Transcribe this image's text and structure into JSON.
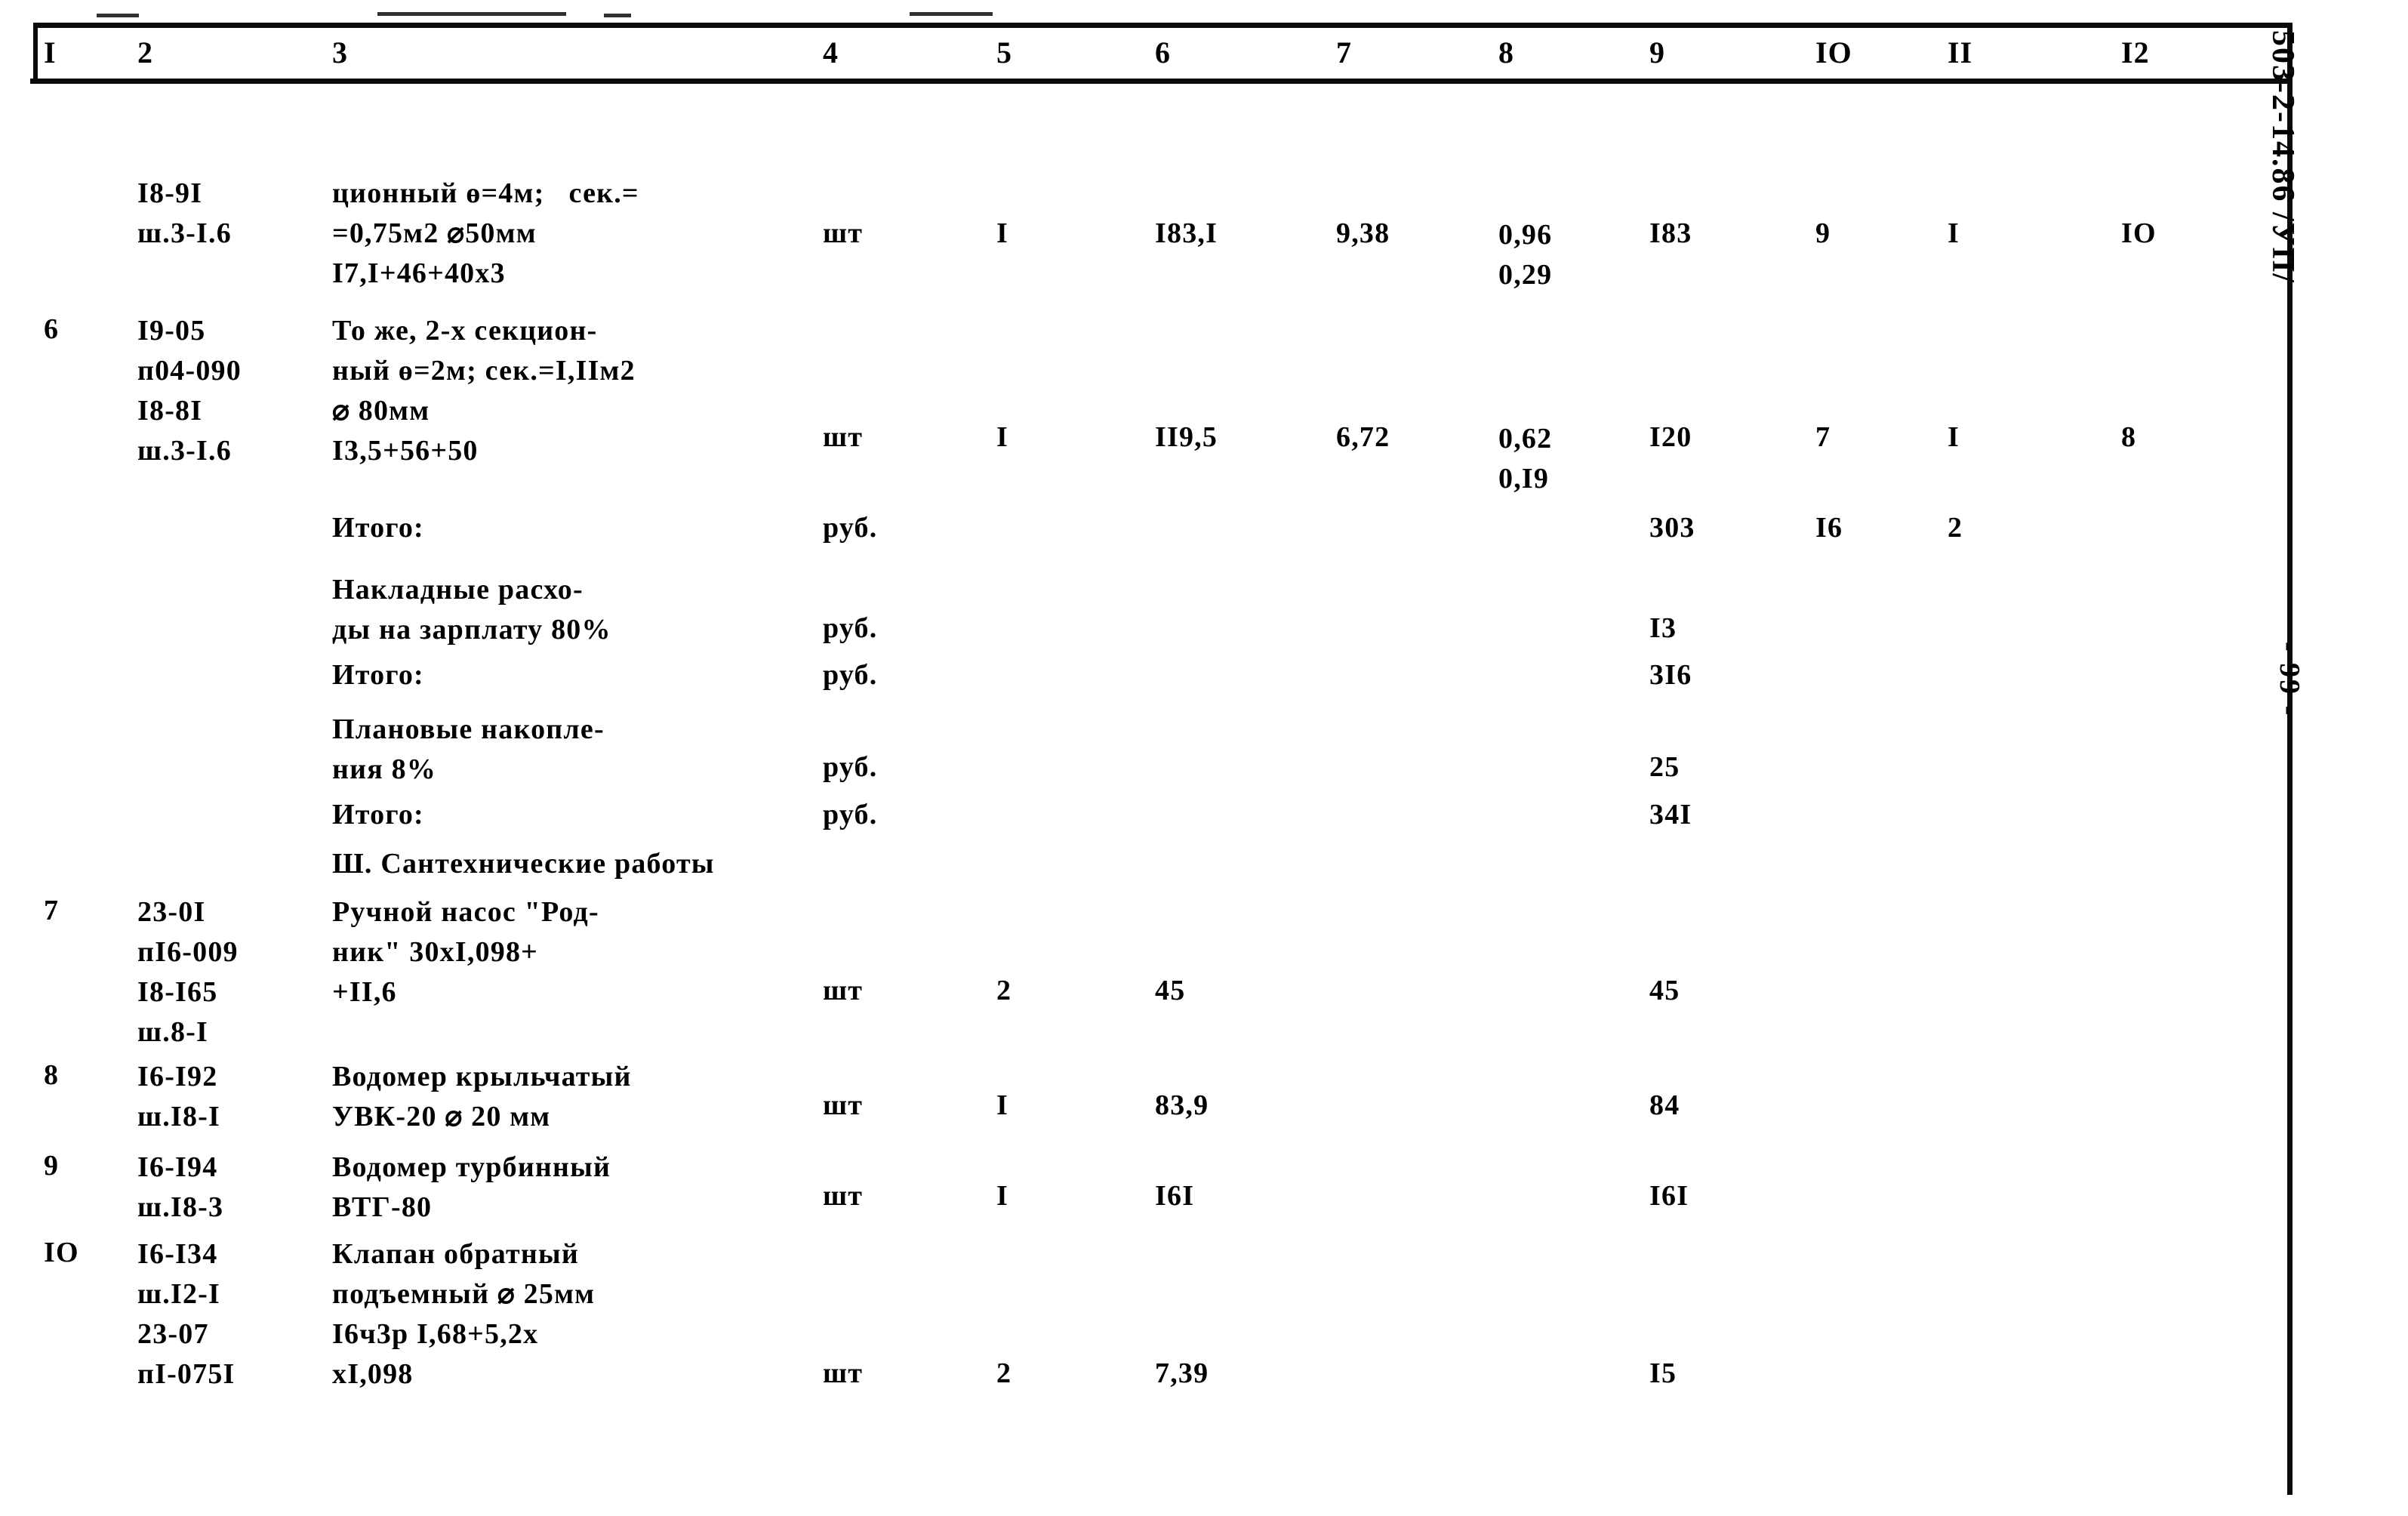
{
  "document": {
    "side_code": "503-2-14.86 /УП/",
    "page_marker": "- 99 -"
  },
  "table": {
    "headers": [
      "I",
      "2",
      "3",
      "4",
      "5",
      "6",
      "7",
      "8",
      "9",
      "IO",
      "II",
      "I2"
    ],
    "rows": [
      {
        "num": "",
        "code": "I8-9I\nш.3-I.6",
        "description": "ционный ө=4м;   сек.=\n=0,75м2 ⌀50мм\nI7,I+46+40х3",
        "unit": "шт",
        "qty": "I",
        "col6": "I83,I",
        "col7": "9,38",
        "col8": "0,96\n0,29",
        "col9": "I83",
        "col10": "9",
        "col11": "I",
        "col12": "IO"
      },
      {
        "num": "6",
        "code": "I9-05\nп04-090\nI8-8I\nш.3-I.6",
        "description": "То же, 2-х секцион-\nный ө=2м; сек.=I,IIм2\n⌀ 80мм\nI3,5+56+50",
        "unit": "шт",
        "qty": "I",
        "col6": "II9,5",
        "col7": "6,72",
        "col8": "0,62\n0,I9",
        "col9": "I20",
        "col10": "7",
        "col11": "I",
        "col12": "8"
      },
      {
        "num": "",
        "code": "",
        "description": "Итого:",
        "unit": "руб.",
        "qty": "",
        "col6": "",
        "col7": "",
        "col8": "",
        "col9": "303",
        "col10": "I6",
        "col11": "2",
        "col12": ""
      },
      {
        "num": "",
        "code": "",
        "description": "Накладные расхо-\nды на зарплату 80%",
        "unit": "руб.",
        "qty": "",
        "col6": "",
        "col7": "",
        "col8": "",
        "col9": "I3",
        "col10": "",
        "col11": "",
        "col12": ""
      },
      {
        "num": "",
        "code": "",
        "description": "Итого:",
        "unit": "руб.",
        "qty": "",
        "col6": "",
        "col7": "",
        "col8": "",
        "col9": "3I6",
        "col10": "",
        "col11": "",
        "col12": ""
      },
      {
        "num": "",
        "code": "",
        "description": "Плановые накопле-\nния 8%",
        "unit": "руб.",
        "qty": "",
        "col6": "",
        "col7": "",
        "col8": "",
        "col9": "25",
        "col10": "",
        "col11": "",
        "col12": ""
      },
      {
        "num": "",
        "code": "",
        "description": "Итого:",
        "unit": "руб.",
        "qty": "",
        "col6": "",
        "col7": "",
        "col8": "",
        "col9": "34I",
        "col10": "",
        "col11": "",
        "col12": ""
      },
      {
        "num": "",
        "code": "",
        "description": "Ш. Сантехнические работы",
        "unit": "",
        "qty": "",
        "col6": "",
        "col7": "",
        "col8": "",
        "col9": "",
        "col10": "",
        "col11": "",
        "col12": ""
      },
      {
        "num": "7",
        "code": "23-0I\nпI6-009\nI8-I65\nш.8-I",
        "description": "Ручной насос \"Род-\nник\" 30хI,098+\n+II,6",
        "unit": "шт",
        "qty": "2",
        "col6": "45",
        "col7": "",
        "col8": "",
        "col9": "45",
        "col10": "",
        "col11": "",
        "col12": ""
      },
      {
        "num": "8",
        "code": "I6-I92\nш.I8-I",
        "description": "Водомер крыльчатый\nУВК-20 ⌀ 20 мм",
        "unit": "шт",
        "qty": "I",
        "col6": "83,9",
        "col7": "",
        "col8": "",
        "col9": "84",
        "col10": "",
        "col11": "",
        "col12": ""
      },
      {
        "num": "9",
        "code": "I6-I94\nш.I8-3",
        "description": "Водомер турбинный\nВТГ-80",
        "unit": "шт",
        "qty": "I",
        "col6": "I6I",
        "col7": "",
        "col8": "",
        "col9": "I6I",
        "col10": "",
        "col11": "",
        "col12": ""
      },
      {
        "num": "IO",
        "code": "I6-I34\nш.I2-I\n23-07\nпI-075I",
        "description": "Клапан обратный\nподъемный ⌀ 25мм\nI6ч3р I,68+5,2х\nхI,098",
        "unit": "шт",
        "qty": "2",
        "col6": "7,39",
        "col7": "",
        "col8": "",
        "col9": "I5",
        "col10": "",
        "col11": "",
        "col12": ""
      }
    ]
  }
}
